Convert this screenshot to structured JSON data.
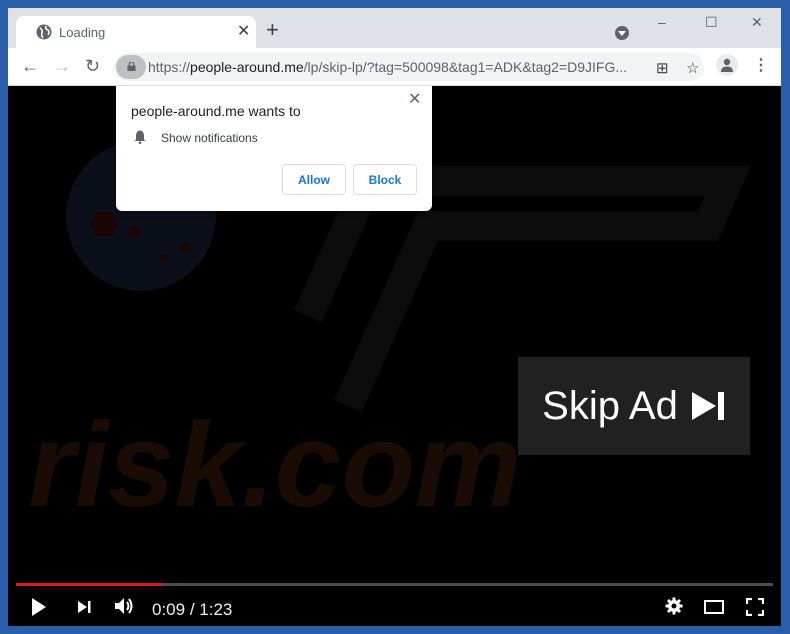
{
  "browser": {
    "tab": {
      "title": "Loading",
      "icon": "globe-icon"
    },
    "new_tab_label": "+",
    "window_controls": {
      "minimize": "–",
      "maximize": "☐",
      "close": "✕"
    },
    "nav": {
      "back": "←",
      "forward": "→",
      "reload": "↻"
    },
    "url": {
      "scheme": "https://",
      "host": "people-around.me",
      "path": "/lp/skip-lp/?tag=500098&tag1=ADK&tag2=D9JIFG..."
    }
  },
  "permission_popup": {
    "title": "people-around.me wants to",
    "permission": "Show notifications",
    "close": "✕",
    "allow_label": "Allow",
    "block_label": "Block"
  },
  "video": {
    "skip_ad_label": "Skip Ad",
    "progress_fraction": 0.193,
    "current_time": "0:09",
    "separator": " / ",
    "duration": "1:23",
    "accent_color": "#e1171e"
  }
}
